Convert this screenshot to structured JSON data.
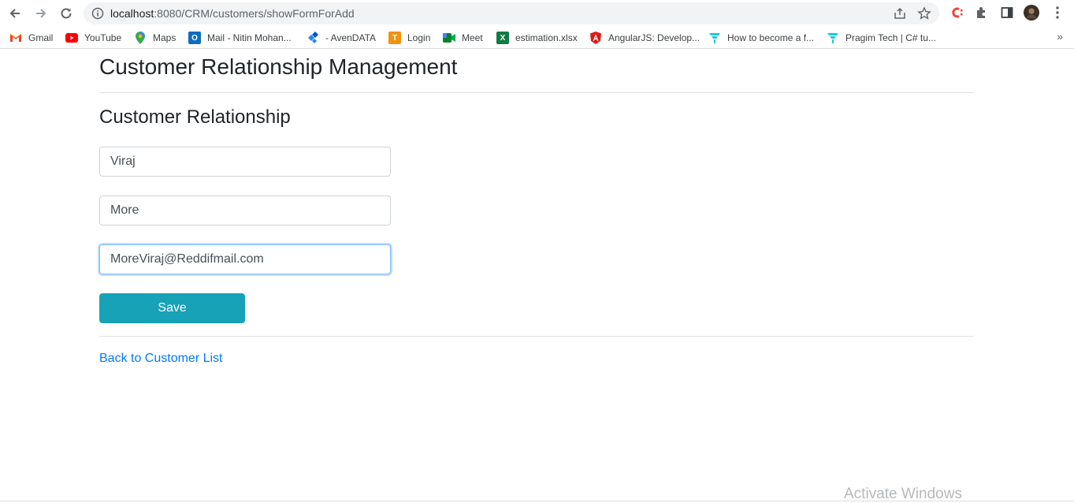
{
  "browser": {
    "url_host": "localhost",
    "url_rest": ":8080/CRM/customers/showFormForAdd",
    "bookmarks": [
      {
        "label": "Gmail",
        "icon": "gmail-icon",
        "color": "#ea4335"
      },
      {
        "label": "YouTube",
        "icon": "youtube-icon",
        "color": "#ff0000"
      },
      {
        "label": "Maps",
        "icon": "maps-icon",
        "color": "#34a853"
      },
      {
        "label": "Mail - Nitin Mohan...",
        "icon": "outlook-icon",
        "color": "#0f6cbd"
      },
      {
        "label": "- AvenDATA",
        "icon": "jira-icon",
        "color": "#2684ff"
      },
      {
        "label": "Login",
        "icon": "login-icon",
        "color": "#f29111"
      },
      {
        "label": "Meet",
        "icon": "meet-icon",
        "color": "#00832d"
      },
      {
        "label": "estimation.xlsx",
        "icon": "excel-icon",
        "color": "#107c41"
      },
      {
        "label": "AngularJS: Develop...",
        "icon": "angular-icon",
        "color": "#dd1b16"
      },
      {
        "label": "How to become a f...",
        "icon": "tech-icon",
        "color": "#1dc7d9"
      },
      {
        "label": "Pragim Tech | C# tu...",
        "icon": "tech-icon",
        "color": "#1dc7d9"
      }
    ],
    "more_bookmarks": "»"
  },
  "page": {
    "title": "Customer Relationship Management",
    "subtitle": "Customer Relationship",
    "first_name": "Viraj",
    "last_name": "More",
    "email": "MoreViraj@Reddifmail.com",
    "save_label": "Save",
    "back_link": "Back to Customer List"
  },
  "watermark": "Activate Windows",
  "colors": {
    "save_button": "#17a2b8",
    "link": "#007bff"
  }
}
